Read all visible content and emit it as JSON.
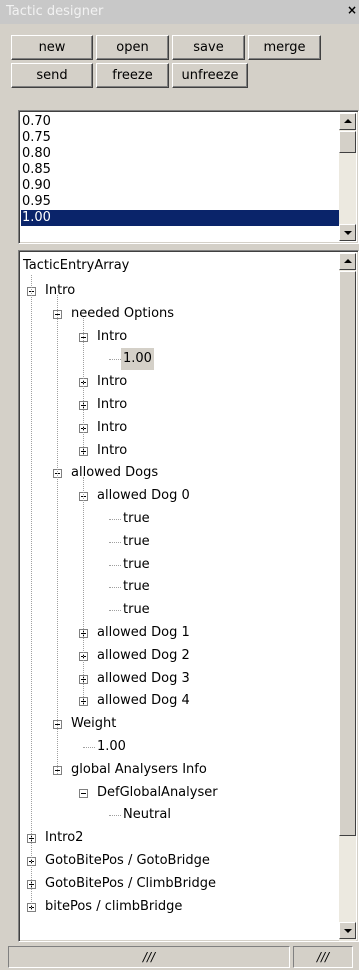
{
  "window": {
    "title": "Tactic designer",
    "close_glyph": "×"
  },
  "toolbar": {
    "row1": [
      "new",
      "open",
      "save",
      "merge"
    ],
    "row2": [
      "send",
      "freeze",
      "unfreeze"
    ]
  },
  "value_list": {
    "items": [
      "0.70",
      "0.75",
      "0.80",
      "0.85",
      "0.90",
      "0.95",
      "1.00"
    ],
    "selected": "1.00"
  },
  "tree": {
    "root": "TacticEntryArray",
    "nodes": [
      {
        "label": "Intro",
        "depth": 1,
        "toggle": "minus"
      },
      {
        "label": "needed Options",
        "depth": 2,
        "toggle": "minus"
      },
      {
        "label": "Intro",
        "depth": 3,
        "toggle": "minus"
      },
      {
        "label": "1.00",
        "depth": 4,
        "toggle": null,
        "highlight": true
      },
      {
        "label": "Intro",
        "depth": 3,
        "toggle": "plus"
      },
      {
        "label": "Intro",
        "depth": 3,
        "toggle": "plus"
      },
      {
        "label": "Intro",
        "depth": 3,
        "toggle": "plus"
      },
      {
        "label": "Intro",
        "depth": 3,
        "toggle": "plus"
      },
      {
        "label": "allowed Dogs",
        "depth": 2,
        "toggle": "minus"
      },
      {
        "label": "allowed Dog 0",
        "depth": 3,
        "toggle": "minus"
      },
      {
        "label": "true",
        "depth": 4,
        "toggle": null
      },
      {
        "label": "true",
        "depth": 4,
        "toggle": null
      },
      {
        "label": "true",
        "depth": 4,
        "toggle": null
      },
      {
        "label": "true",
        "depth": 4,
        "toggle": null
      },
      {
        "label": "true",
        "depth": 4,
        "toggle": null
      },
      {
        "label": "allowed Dog 1",
        "depth": 3,
        "toggle": "plus"
      },
      {
        "label": "allowed Dog 2",
        "depth": 3,
        "toggle": "plus"
      },
      {
        "label": "allowed Dog 3",
        "depth": 3,
        "toggle": "plus"
      },
      {
        "label": "allowed Dog 4",
        "depth": 3,
        "toggle": "plus"
      },
      {
        "label": "Weight",
        "depth": 2,
        "toggle": "minus"
      },
      {
        "label": "1.00",
        "depth": 3,
        "toggle": null
      },
      {
        "label": "global Analysers Info",
        "depth": 2,
        "toggle": "minus"
      },
      {
        "label": "DefGlobalAnalyser",
        "depth": 3,
        "toggle": "minus"
      },
      {
        "label": "Neutral",
        "depth": 4,
        "toggle": null
      },
      {
        "label": "Intro2",
        "depth": 1,
        "toggle": "plus"
      },
      {
        "label": "GotoBitePos / GotoBridge",
        "depth": 1,
        "toggle": "plus"
      },
      {
        "label": "GotoBitePos / ClimbBridge",
        "depth": 1,
        "toggle": "plus"
      },
      {
        "label": "bitePos / climbBridge",
        "depth": 1,
        "toggle": "plus"
      }
    ]
  },
  "statusbar": {
    "panels": [
      "///",
      "///"
    ]
  },
  "colors": {
    "selection": "#0a246a",
    "face": "#d4d0c8",
    "titlebar": "#c8c8c8"
  }
}
